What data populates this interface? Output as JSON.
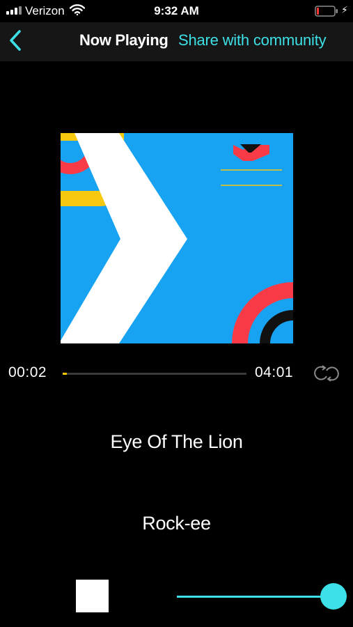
{
  "status_bar": {
    "carrier": "Verizon",
    "time": "9:32 AM",
    "battery_level": 0.1,
    "battery_color": "#ff3b30",
    "icons": [
      "signal-icon",
      "wifi-icon",
      "battery-icon",
      "charging-bolt-icon"
    ]
  },
  "header": {
    "back_icon": "chevron-left-icon",
    "title": "Now Playing",
    "action": "Share with community"
  },
  "player": {
    "elapsed": "00:02",
    "duration": "04:01",
    "progress": 0.008,
    "repeat_icon": "repeat-icon",
    "song_title": "Eye Of The Lion",
    "artist": "Rock-ee",
    "stop_icon": "stop-icon",
    "volume": 1.0
  },
  "colors": {
    "accent": "#3de0e6",
    "progress": "#f2c200",
    "art_background": "#17a3f2",
    "art_red": "#f93b47",
    "art_yellow": "#f7c810"
  }
}
